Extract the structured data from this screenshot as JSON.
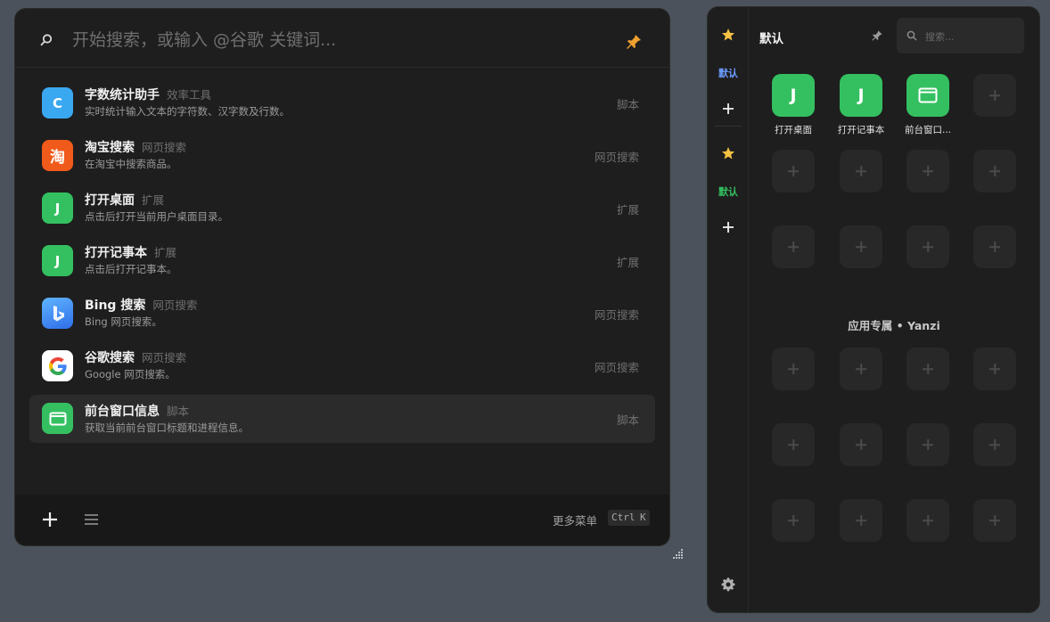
{
  "launcher": {
    "search_placeholder": "开始搜索，或输入 @谷歌 关键词...",
    "results": [
      {
        "name": "字数统计助手",
        "category": "效率工具",
        "desc": "实时统计输入文本的字符数、汉字数及行数。",
        "type": "脚本",
        "icon": "letter-c-icon",
        "icon_text": "C",
        "icon_color": "#3aa8f0"
      },
      {
        "name": "淘宝搜索",
        "category": "网页搜索",
        "desc": "在淘宝中搜索商品。",
        "type": "网页搜索",
        "icon": "taobao-icon",
        "icon_text": "淘",
        "icon_color": "#f05a1a"
      },
      {
        "name": "打开桌面",
        "category": "扩展",
        "desc": "点击后打开当前用户桌面目录。",
        "type": "扩展",
        "icon": "letter-j-icon",
        "icon_text": "J",
        "icon_color": "#34c060"
      },
      {
        "name": "打开记事本",
        "category": "扩展",
        "desc": "点击后打开记事本。",
        "type": "扩展",
        "icon": "letter-j-icon",
        "icon_text": "J",
        "icon_color": "#34c060"
      },
      {
        "name": "Bing 搜索",
        "category": "网页搜索",
        "desc": "Bing 网页搜索。",
        "type": "网页搜索",
        "icon": "bing-icon",
        "icon_text": "",
        "icon_color": "#3b8df5"
      },
      {
        "name": "谷歌搜索",
        "category": "网页搜索",
        "desc": "Google 网页搜索。",
        "type": "网页搜索",
        "icon": "google-icon",
        "icon_text": "",
        "icon_color": "#ffffff"
      },
      {
        "name": "前台窗口信息",
        "category": "脚本",
        "desc": "获取当前前台窗口标题和进程信息。",
        "type": "脚本",
        "icon": "window-icon",
        "icon_text": "",
        "icon_color": "#34c060"
      }
    ],
    "selected_index": 6,
    "footer": {
      "more_menu": "更多菜单",
      "key1": "Ctrl",
      "key2": "K"
    }
  },
  "panel": {
    "rail": {
      "group1_label": "默认",
      "group2_label": "默认",
      "group1_color": "#6b9cff",
      "group2_color": "#34c060"
    },
    "title": "默认",
    "search_placeholder": "搜索...",
    "apps": [
      {
        "label": "打开桌面",
        "icon": "letter-j-icon",
        "icon_text": "J"
      },
      {
        "label": "打开记事本",
        "icon": "letter-j-icon",
        "icon_text": "J"
      },
      {
        "label": "前台窗口...",
        "icon": "window-icon",
        "icon_text": ""
      }
    ],
    "section_label": "应用专属 • Yanzi"
  },
  "colors": {
    "accent_orange": "#f0a030",
    "star": "#f5c242",
    "app_green": "#34c060"
  }
}
